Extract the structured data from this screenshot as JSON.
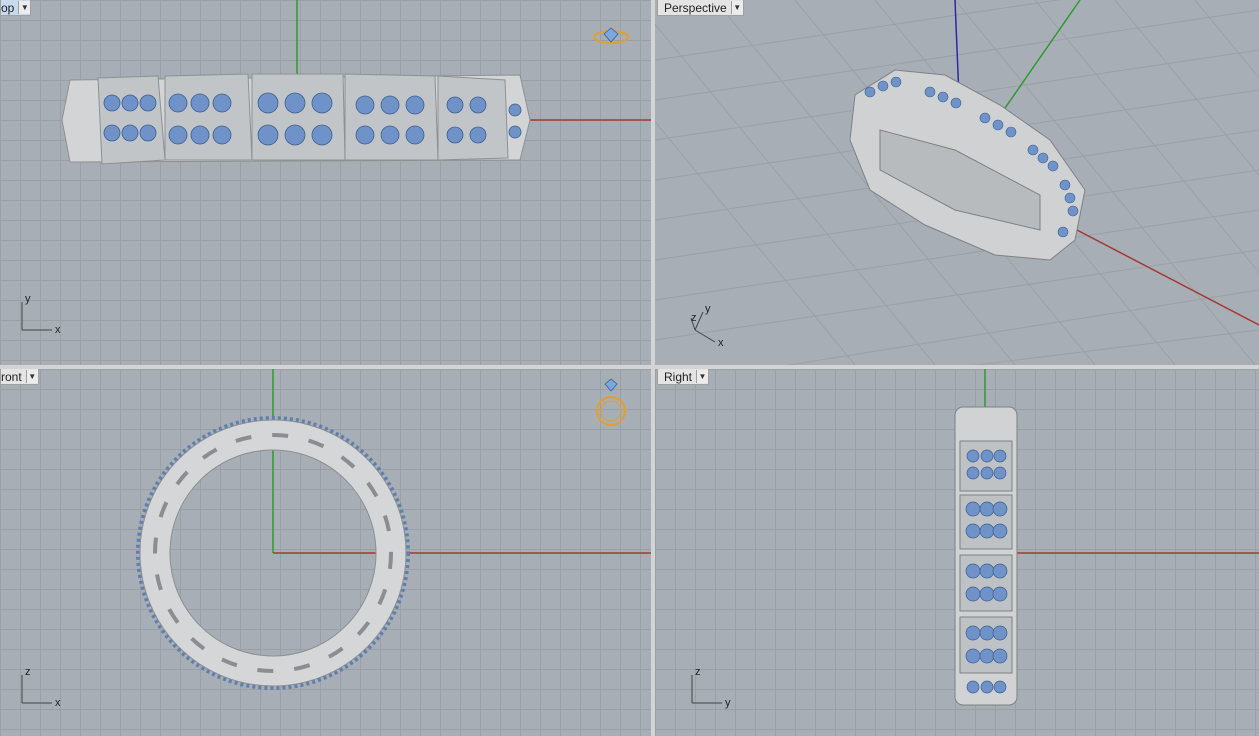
{
  "viewports": {
    "top": {
      "label": "op",
      "axis_x": "x",
      "axis_y": "y"
    },
    "perspective": {
      "label": "Perspective",
      "axis_x": "x",
      "axis_y": "y",
      "axis_z": "z"
    },
    "front": {
      "label": "ront",
      "axis_x": "x",
      "axis_y": "z"
    },
    "right": {
      "label": "Right",
      "axis_x": "y",
      "axis_y": "z"
    }
  },
  "icons": {
    "top_widget": "ring-top-view-icon",
    "front_widget": "ring-front-view-icon"
  },
  "colors": {
    "background": "#a8aeb5",
    "x_axis": "#a33a32",
    "y_axis": "#2f9a2f",
    "z_axis": "#2a2aa8",
    "metal": "#d6d8da",
    "gem": "#6f93c8",
    "widget": "#e0a030"
  }
}
